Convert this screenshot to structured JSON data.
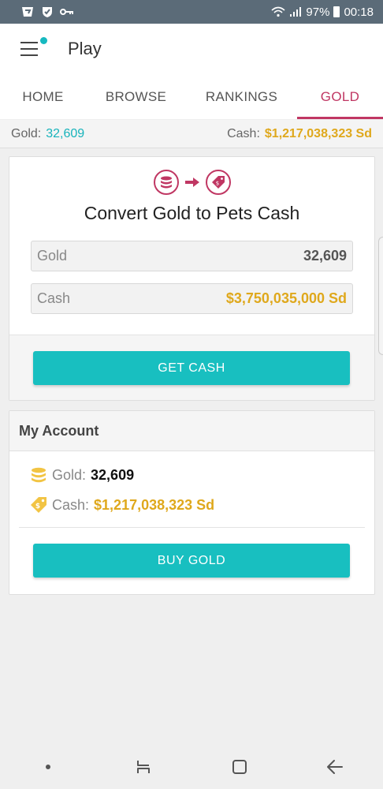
{
  "status_bar": {
    "battery": "97%",
    "time": "00:18",
    "icons": [
      "app-icon",
      "shield-icon",
      "key-icon",
      "wifi-icon",
      "signal-icon",
      "battery-icon"
    ]
  },
  "app_bar": {
    "title": "Play",
    "menu_icon": "hamburger-menu-icon",
    "notification_color": "#16b9c0"
  },
  "tabs": [
    {
      "label": "HOME",
      "active": false
    },
    {
      "label": "BROWSE",
      "active": false
    },
    {
      "label": "RANKINGS",
      "active": false
    },
    {
      "label": "GOLD",
      "active": true
    }
  ],
  "balance_bar": {
    "gold_label": "Gold:",
    "gold_value": "32,609",
    "cash_label": "Cash:",
    "cash_value": "$1,217,038,323 Sd"
  },
  "convert": {
    "icons": [
      "gold-coins-icon",
      "arrow-right-icon",
      "cash-tag-icon"
    ],
    "title": "Convert Gold to Pets Cash",
    "gold_field": {
      "label": "Gold",
      "value": "32,609"
    },
    "cash_field": {
      "label": "Cash",
      "value": "$3,750,035,000 Sd"
    },
    "button": "GET CASH"
  },
  "account": {
    "header": "My Account",
    "gold_label": "Gold:",
    "gold_value": "32,609",
    "cash_label": "Cash:",
    "cash_value": "$1,217,038,323 Sd",
    "button": "BUY GOLD"
  },
  "nav_bar": {
    "icons": [
      "dot-icon",
      "recent-apps-icon",
      "home-icon",
      "back-icon"
    ]
  },
  "colors": {
    "accent": "#c03763",
    "teal": "#18bfc0",
    "gold": "#dfa81c",
    "status_bar": "#5b6b78"
  }
}
